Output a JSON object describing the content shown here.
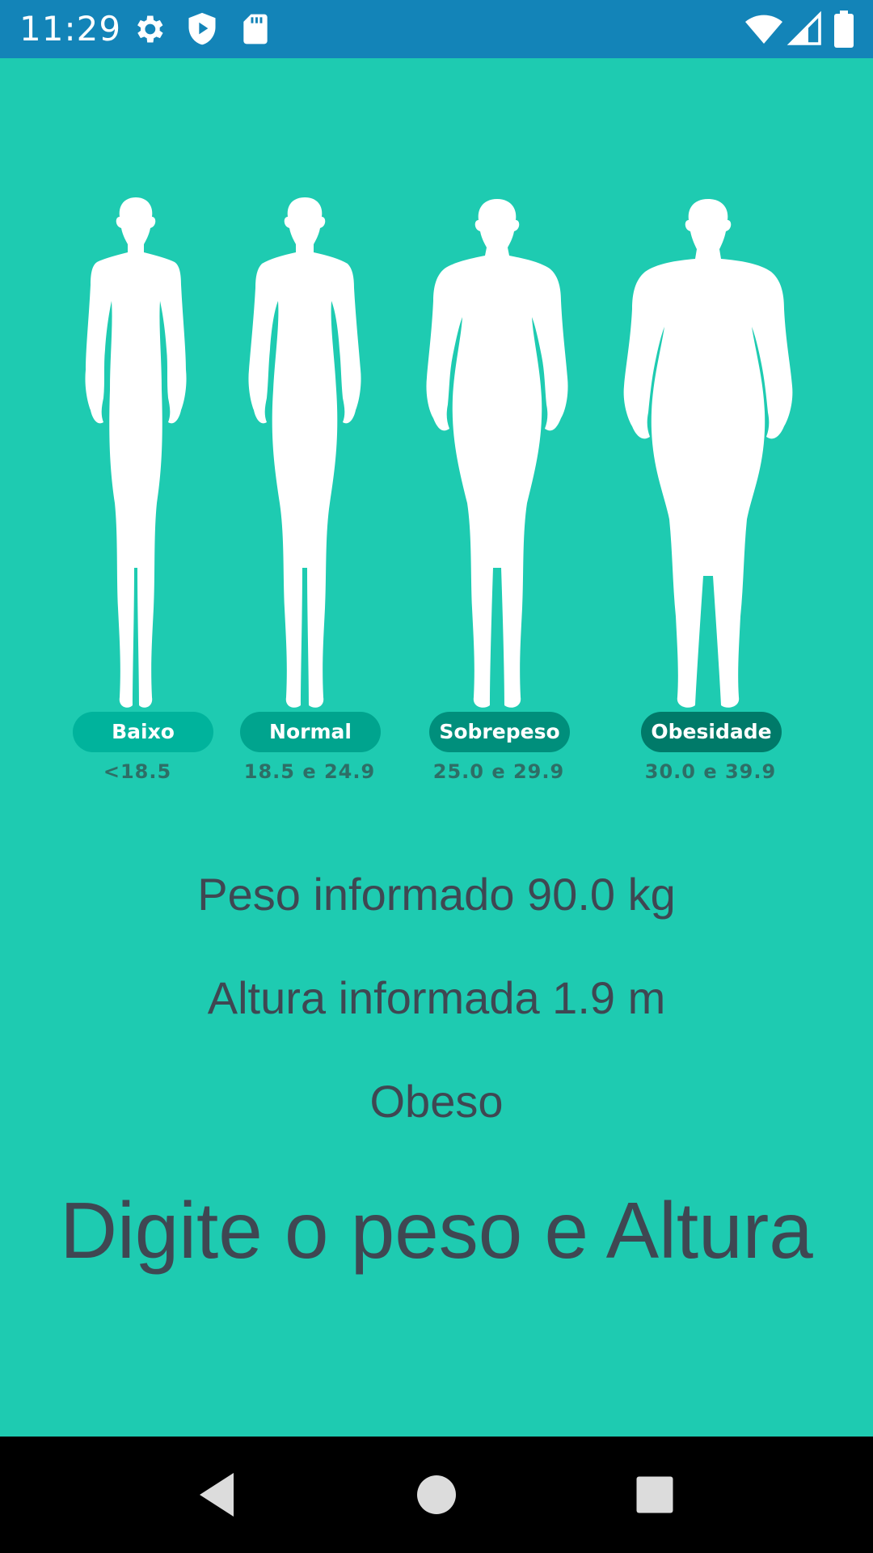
{
  "status_bar": {
    "time": "11:29",
    "icons_left": [
      "gear-icon",
      "shield-play-icon",
      "sd-card-icon"
    ],
    "icons_right": [
      "wifi-icon",
      "signal-icon",
      "battery-icon"
    ]
  },
  "categories": [
    {
      "label": "Baixo",
      "range": "<18.5",
      "pill_color": "#00b39c"
    },
    {
      "label": "Normal",
      "range": "18.5 e 24.9",
      "pill_color": "#00a48e"
    },
    {
      "label": "Sobrepeso",
      "range": "25.0 e 29.9",
      "pill_color": "#008f7c"
    },
    {
      "label": "Obesidade",
      "range": "30.0 e 39.9",
      "pill_color": "#007a69"
    }
  ],
  "result": {
    "peso": "Peso informado 90.0 kg",
    "altura": "Altura informada 1.9 m",
    "classificacao": "Obeso",
    "instrucao": "Digite o peso e Altura"
  },
  "colors": {
    "background": "#1ecbb1",
    "status_bar": "#1384b8",
    "text": "#3f4752",
    "nav_bar": "#000000"
  },
  "nav": {
    "icons": [
      "back-icon",
      "home-icon",
      "recents-icon"
    ]
  }
}
